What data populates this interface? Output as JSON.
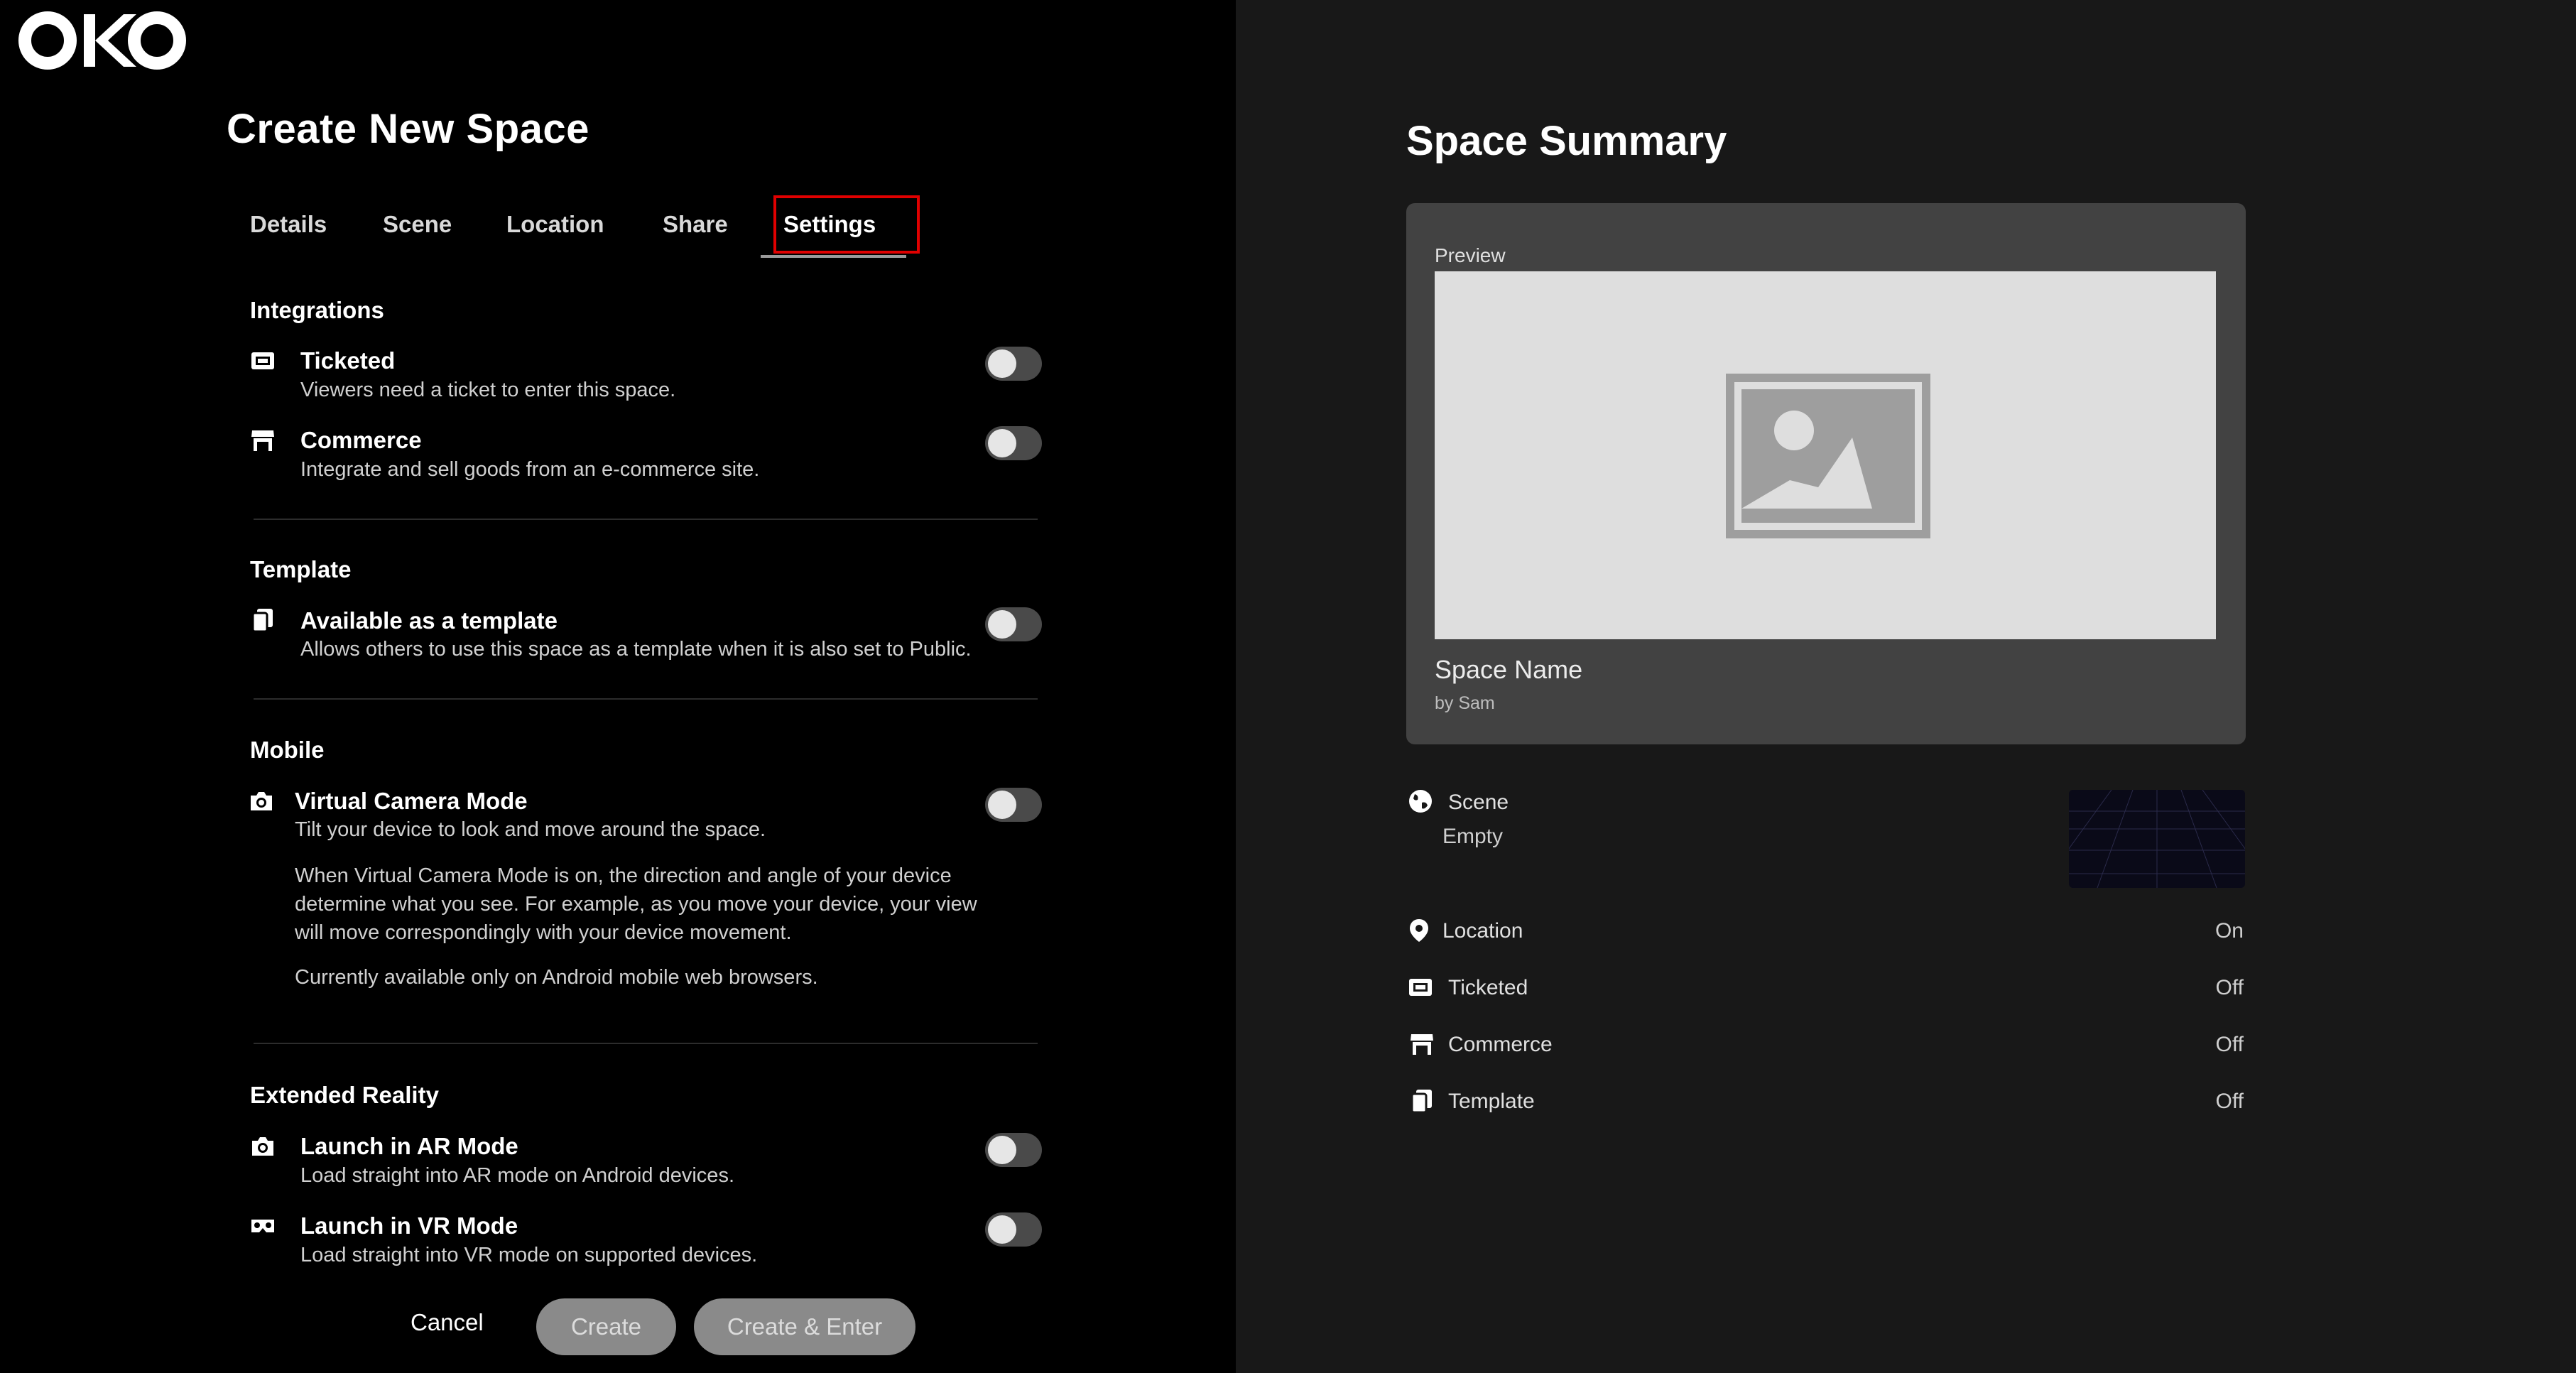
{
  "app": {
    "logo_text": "OKO"
  },
  "page": {
    "title": "Create New Space"
  },
  "tabs": [
    {
      "label": "Details"
    },
    {
      "label": "Scene"
    },
    {
      "label": "Location"
    },
    {
      "label": "Share"
    },
    {
      "label": "Settings",
      "active": true
    }
  ],
  "sections": {
    "integrations": {
      "heading": "Integrations",
      "ticketed": {
        "title": "Ticketed",
        "desc": "Viewers need a ticket to enter this space.",
        "enabled": false
      },
      "commerce": {
        "title": "Commerce",
        "desc": "Integrate and sell goods from an e-commerce site.",
        "enabled": false
      }
    },
    "template": {
      "heading": "Template",
      "available": {
        "title": "Available as a template",
        "desc": "Allows others to use this space as a template when it is also set to Public.",
        "enabled": false
      }
    },
    "mobile": {
      "heading": "Mobile",
      "vcam": {
        "title": "Virtual Camera Mode",
        "desc": "Tilt your device to look and move around the space.",
        "para1": "When Virtual Camera Mode is on, the direction and angle of your device determine what you see. For example, as you move your device, your view will move correspondingly with your device movement.",
        "para2": "Currently available only on Android mobile web browsers.",
        "enabled": false
      }
    },
    "xr": {
      "heading": "Extended Reality",
      "ar": {
        "title": "Launch in AR Mode",
        "desc": "Load straight into AR mode on Android devices.",
        "enabled": false
      },
      "vr": {
        "title": "Launch in VR Mode",
        "desc": "Load straight into VR mode on supported devices.",
        "enabled": false
      }
    }
  },
  "footer": {
    "cancel": "Cancel",
    "create": "Create",
    "create_enter": "Create & Enter"
  },
  "summary": {
    "title": "Space Summary",
    "preview_label": "Preview",
    "space_name": "Space Name",
    "by": "by Sam",
    "scene": {
      "label": "Scene",
      "value": "Empty"
    },
    "location": {
      "label": "Location",
      "value": "On"
    },
    "ticketed": {
      "label": "Ticketed",
      "value": "Off"
    },
    "commerce": {
      "label": "Commerce",
      "value": "Off"
    },
    "template": {
      "label": "Template",
      "value": "Off"
    }
  },
  "colors": {
    "highlight": "#e00000",
    "toggle_off": "#4a4a4a",
    "button_disabled": "#8a8a8a"
  }
}
